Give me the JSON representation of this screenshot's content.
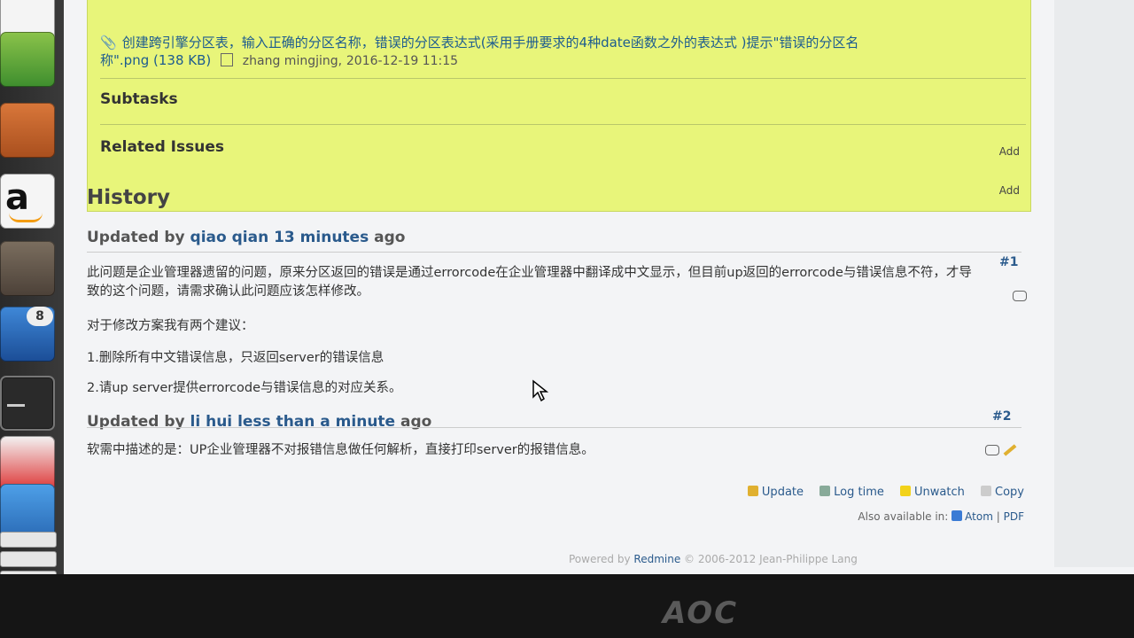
{
  "attachment": {
    "filename_part1": "创建跨引擎分区表，输入正确的分区名称，错误的分区表达式(采用手册要求的4种date函数之外的表达式 )提示\"错误的分区名",
    "filename_part2": "称\".png",
    "size": "(138 KB)",
    "author": "zhang mingjing,",
    "date": "2016-12-19 11:15"
  },
  "sections": {
    "subtasks": "Subtasks",
    "related_issues": "Related Issues",
    "add_label": "Add"
  },
  "history": {
    "title": "History",
    "entries": [
      {
        "prefix": "Updated by",
        "user": "qiao qian",
        "time": "13 minutes",
        "suffix": "ago",
        "number": "#1",
        "paragraphs": [
          "此问题是企业管理器遗留的问题，原来分区返回的错误是通过errorcode在企业管理器中翻译成中文显示，但目前up返回的errorcode与错误信息不符，才导致的这个问题，请需求确认此问题应该怎样修改。",
          "对于修改方案我有两个建议：",
          "1.删除所有中文错误信息，只返回server的错误信息",
          "2.请up server提供errorcode与错误信息的对应关系。"
        ]
      },
      {
        "prefix": "Updated by",
        "user": "li hui",
        "time": "less than a minute",
        "suffix": "ago",
        "number": "#2",
        "paragraphs": [
          "软需中描述的是：UP企业管理器不对报错信息做任何解析，直接打印server的报错信息。"
        ]
      }
    ]
  },
  "actions": {
    "update": "Update",
    "log_time": "Log time",
    "unwatch": "Unwatch",
    "copy": "Copy"
  },
  "also_available": {
    "label": "Also available in:",
    "atom": "Atom",
    "sep": "|",
    "pdf": "PDF"
  },
  "footer": {
    "powered": "Powered by",
    "redmine": "Redmine",
    "copyright": "© 2006-2012 Jean-Philippe Lang"
  },
  "launcher": {
    "badge": "8",
    "amazon": "a"
  },
  "monitor_brand": "AOC"
}
